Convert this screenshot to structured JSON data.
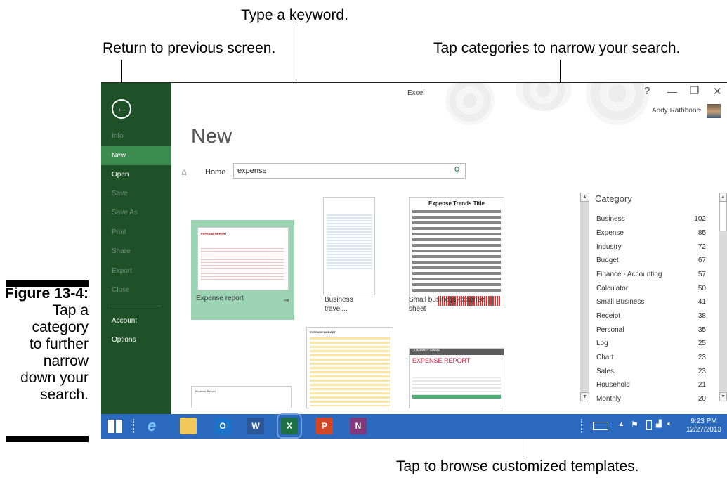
{
  "callouts": {
    "keyword": "Type a keyword.",
    "return": "Return to previous screen.",
    "categories": "Tap categories to narrow your search.",
    "browse": "Tap to browse customized templates."
  },
  "figure": {
    "label": "Figure 13-4:",
    "caption_lines": [
      "Tap a",
      "category",
      "to further",
      "narrow",
      "down your",
      "search."
    ]
  },
  "window": {
    "app_title": "Excel",
    "help": "?",
    "minimize": "—",
    "restore": "❐",
    "close": "✕",
    "user_name": "Andy Rathbone"
  },
  "sidebar": {
    "back_icon": "←",
    "items": [
      {
        "label": "Info",
        "state": "disabled"
      },
      {
        "label": "New",
        "state": "active"
      },
      {
        "label": "Open",
        "state": "enabled"
      },
      {
        "label": "Save",
        "state": "disabled"
      },
      {
        "label": "Save As",
        "state": "disabled"
      },
      {
        "label": "Print",
        "state": "disabled"
      },
      {
        "label": "Share",
        "state": "disabled"
      },
      {
        "label": "Export",
        "state": "disabled"
      },
      {
        "label": "Close",
        "state": "disabled"
      },
      {
        "label": "Account",
        "state": "enabled"
      },
      {
        "label": "Options",
        "state": "enabled"
      }
    ]
  },
  "main": {
    "page_title": "New",
    "home_label": "Home",
    "search_value": "expense",
    "templates": [
      {
        "name": "Expense report",
        "selected": true
      },
      {
        "name": "Business travel...",
        "selected": false
      },
      {
        "name": "Small business expense sheet",
        "selected": false
      }
    ],
    "thumb_text": {
      "expense_report_header": "EXPENSE REPORT",
      "trends_title": "Expense Trends Title",
      "company_name": "COMPANY NAME",
      "company_report": "EXPENSE REPORT",
      "small_report": "Expense Report",
      "budget_header": "EXPENSE BUDGET"
    }
  },
  "category_panel": {
    "title": "Category",
    "items": [
      {
        "label": "Business",
        "count": "102"
      },
      {
        "label": "Expense",
        "count": "85"
      },
      {
        "label": "Industry",
        "count": "72"
      },
      {
        "label": "Budget",
        "count": "67"
      },
      {
        "label": "Finance - Accounting",
        "count": "57"
      },
      {
        "label": "Calculator",
        "count": "50"
      },
      {
        "label": "Small Business",
        "count": "41"
      },
      {
        "label": "Receipt",
        "count": "38"
      },
      {
        "label": "Personal",
        "count": "35"
      },
      {
        "label": "Log",
        "count": "25"
      },
      {
        "label": "Chart",
        "count": "23"
      },
      {
        "label": "Sales",
        "count": "23"
      },
      {
        "label": "Household",
        "count": "21"
      },
      {
        "label": "Monthly",
        "count": "20"
      }
    ]
  },
  "taskbar": {
    "apps": [
      {
        "name": "internet-explorer",
        "glyph": "e",
        "color": "#3aa0e8"
      },
      {
        "name": "file-explorer",
        "glyph": "",
        "color": "#f1c75a"
      },
      {
        "name": "outlook",
        "glyph": "O",
        "color": "#1a73c8"
      },
      {
        "name": "word",
        "glyph": "W",
        "color": "#2b5797"
      },
      {
        "name": "excel",
        "glyph": "X",
        "color": "#1e7145"
      },
      {
        "name": "powerpoint",
        "glyph": "P",
        "color": "#d24726"
      },
      {
        "name": "onenote",
        "glyph": "N",
        "color": "#80397b"
      }
    ],
    "time": "9:23 PM",
    "date": "12/27/2013"
  },
  "colors": {
    "sidebar": "#1e5128",
    "active_item": "#3c8c50",
    "selected_template": "#9bd3b4",
    "taskbar": "#2c6ac0"
  }
}
